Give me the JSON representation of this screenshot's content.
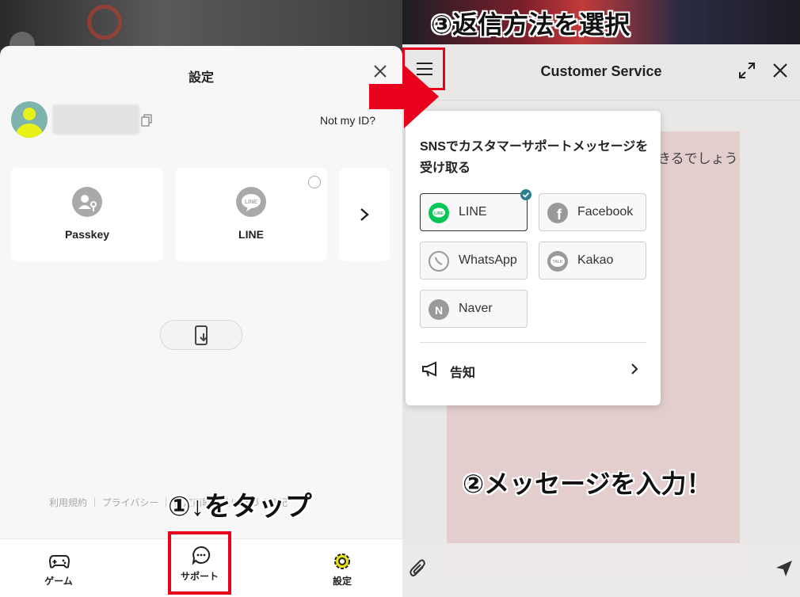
{
  "left_panel": {
    "title": "設定",
    "not_my_id": "Not my ID?",
    "login_cards": [
      {
        "label": "Passkey",
        "icon": "passkey-icon"
      },
      {
        "label": "LINE",
        "icon": "line-icon"
      }
    ],
    "footer_links": "利用規約 ｜ プライバシー ｜ 特定商取引法に基づく表記",
    "nav": [
      {
        "label": "ゲーム",
        "icon": "gamepad-icon"
      },
      {
        "label": "サポート",
        "icon": "chat-icon"
      },
      {
        "label": "設定",
        "icon": "gear-icon"
      }
    ],
    "annotation": "①↓をタップ"
  },
  "right_panel": {
    "annotation_top": "③返信方法を選択",
    "title": "Customer Service",
    "bg_text": "きるでしょう",
    "dropdown": {
      "heading": "SNSでカスタマーサポートメッセージを受け取る",
      "options": [
        {
          "label": "LINE",
          "icon": "line-icon",
          "selected": true
        },
        {
          "label": "Facebook",
          "icon": "facebook-icon",
          "selected": false
        },
        {
          "label": "WhatsApp",
          "icon": "whatsapp-icon",
          "selected": false
        },
        {
          "label": "Kakao",
          "icon": "kakao-icon",
          "selected": false
        },
        {
          "label": "Naver",
          "icon": "naver-icon",
          "selected": false
        }
      ],
      "notice_label": "告知"
    },
    "annotation_middle": "②メッセージを入力！",
    "colors": {
      "highlight_red": "#e8001c",
      "line_green": "#06c755",
      "check_teal": "#2a7f8f"
    }
  }
}
